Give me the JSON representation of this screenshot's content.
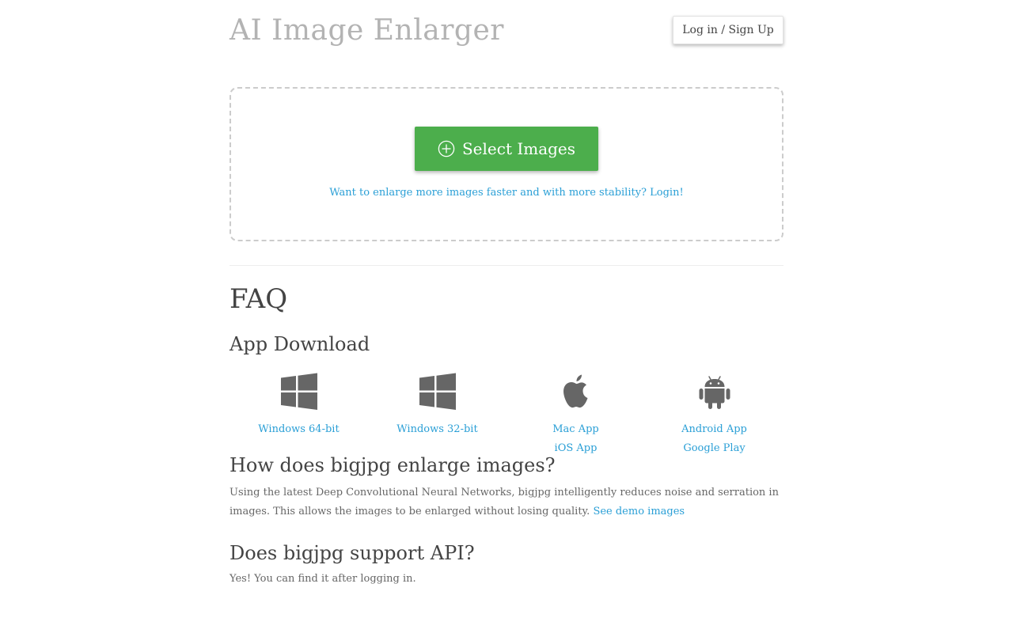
{
  "header": {
    "title": "AI Image Enlarger",
    "login_label": "Log in / Sign Up"
  },
  "upload": {
    "select_label": "Select Images",
    "select_icon": "plus-circle-icon",
    "login_hint": "Want to enlarge more images faster and with more stability? Login!"
  },
  "faq": {
    "title": "FAQ",
    "app_download": {
      "title": "App Download",
      "apps": [
        {
          "icon": "windows-icon",
          "links": [
            "Windows 64-bit"
          ]
        },
        {
          "icon": "windows-icon",
          "links": [
            "Windows 32-bit"
          ]
        },
        {
          "icon": "apple-icon",
          "links": [
            "Mac App",
            "iOS App"
          ]
        },
        {
          "icon": "android-icon",
          "links": [
            "Android App",
            "Google Play"
          ]
        }
      ]
    },
    "questions": [
      {
        "title": "How does bigjpg enlarge images?",
        "answer": "Using the latest Deep Convolutional Neural Networks, bigjpg intelligently reduces noise and serration in images. This allows the images to be enlarged without losing quality.",
        "link": "See demo images"
      },
      {
        "title": "Does bigjpg support API?",
        "answer": "Yes! You can find it after logging in."
      }
    ]
  },
  "colors": {
    "accent_link": "#2a9fd6",
    "primary_button": "#4cae4c",
    "icon_gray": "#666666",
    "title_gray": "#b3b3b3"
  }
}
